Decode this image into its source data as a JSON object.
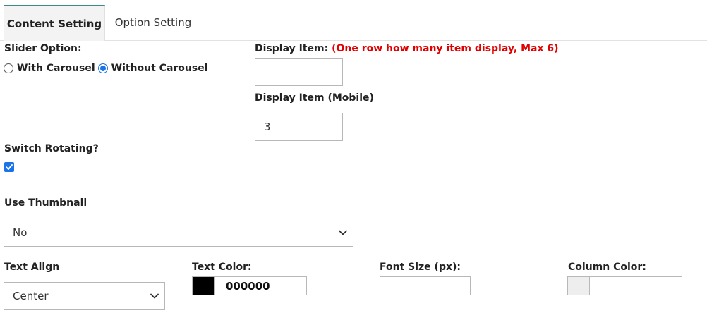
{
  "tabs": {
    "content": "Content Setting",
    "option": "Option Setting"
  },
  "slider": {
    "label": "Slider Option:",
    "with_carousel": "With Carousel",
    "without_carousel": "Without Carousel",
    "selected": "without_carousel"
  },
  "display_item": {
    "label": "Display Item:",
    "note": "(One row how many item display, Max 6)",
    "value": ""
  },
  "display_item_mobile": {
    "label": "Display Item (Mobile)",
    "value": "3"
  },
  "switch_rotating": {
    "label": "Switch Rotating?",
    "checked": true
  },
  "thumbnail": {
    "label": "Use Thumbnail",
    "selected": "No"
  },
  "text_align": {
    "label": "Text Align",
    "selected": "Center"
  },
  "text_color": {
    "label": "Text Color:",
    "value": "000000",
    "swatch": "#000000"
  },
  "font_size": {
    "label": "Font Size (px):",
    "value": ""
  },
  "column_color": {
    "label": "Column Color:",
    "value": "",
    "swatch": "#eeeeee"
  },
  "colors": {
    "accent": "#3a8d86",
    "note_red": "#e00000",
    "check_blue": "#1a73e8"
  },
  "icons": {
    "dropdown": "chevron-down-icon",
    "check": "check-icon"
  }
}
